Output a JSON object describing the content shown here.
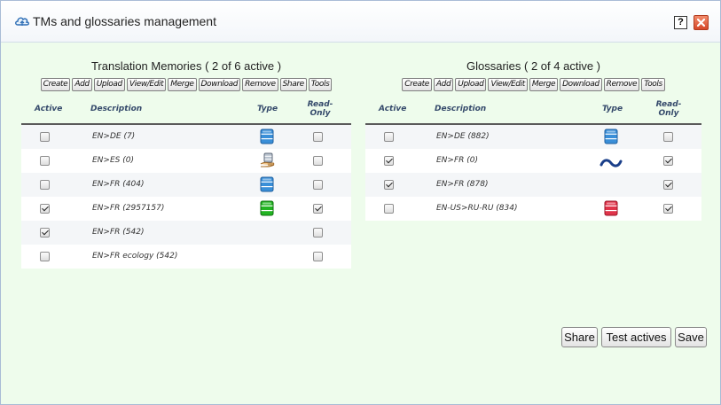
{
  "window": {
    "title": "TMs and glossaries management",
    "help_label": "?"
  },
  "tm_panel": {
    "title": "Translation Memories  ( 2 of 6 active )",
    "toolbar": [
      "Create",
      "Add",
      "Upload",
      "View/Edit",
      "Merge",
      "Download",
      "Remove",
      "Share",
      "Tools"
    ],
    "headers": {
      "active": "Active",
      "description": "Description",
      "type": "Type",
      "read_only_1": "Read-",
      "read_only_2": "Only"
    },
    "rows": [
      {
        "active": false,
        "description": "EN>DE (7)",
        "type": "db-blue-icon",
        "read_only": false
      },
      {
        "active": false,
        "description": "EN>ES (0)",
        "type": "db-hand-icon",
        "read_only": false
      },
      {
        "active": false,
        "description": "EN>FR (404)",
        "type": "db-blue-icon",
        "read_only": false
      },
      {
        "active": true,
        "description": "EN>FR (2957157)",
        "type": "db-green-icon",
        "read_only": true
      },
      {
        "active": true,
        "description": "EN>FR (542)",
        "type": "",
        "read_only": false
      },
      {
        "active": false,
        "description": "EN>FR ecology (542)",
        "type": "",
        "read_only": false
      }
    ]
  },
  "gl_panel": {
    "title": "Glossaries  ( 2 of 4 active )",
    "toolbar": [
      "Create",
      "Add",
      "Upload",
      "View/Edit",
      "Merge",
      "Download",
      "Remove",
      "Tools"
    ],
    "headers": {
      "active": "Active",
      "description": "Description",
      "type": "Type",
      "read_only_1": "Read-",
      "read_only_2": "Only"
    },
    "rows": [
      {
        "active": false,
        "description": "EN>DE (882)",
        "type": "db-blue-icon",
        "read_only": false
      },
      {
        "active": true,
        "description": "EN>FR (0)",
        "type": "tilde-icon",
        "read_only": true
      },
      {
        "active": true,
        "description": "EN>FR (878)",
        "type": "",
        "read_only": true
      },
      {
        "active": false,
        "description": "EN-US>RU-RU (834)",
        "type": "db-red-icon",
        "read_only": true
      }
    ]
  },
  "actions": {
    "share": "Share",
    "test_actives": "Test actives",
    "save": "Save"
  },
  "colors": {
    "body_bg": "#eefcec",
    "header_text": "#354a6b",
    "db_blue": "#3a8fd8",
    "db_green": "#22b422",
    "db_red": "#e0344a",
    "tilde": "#1a3f8a"
  }
}
